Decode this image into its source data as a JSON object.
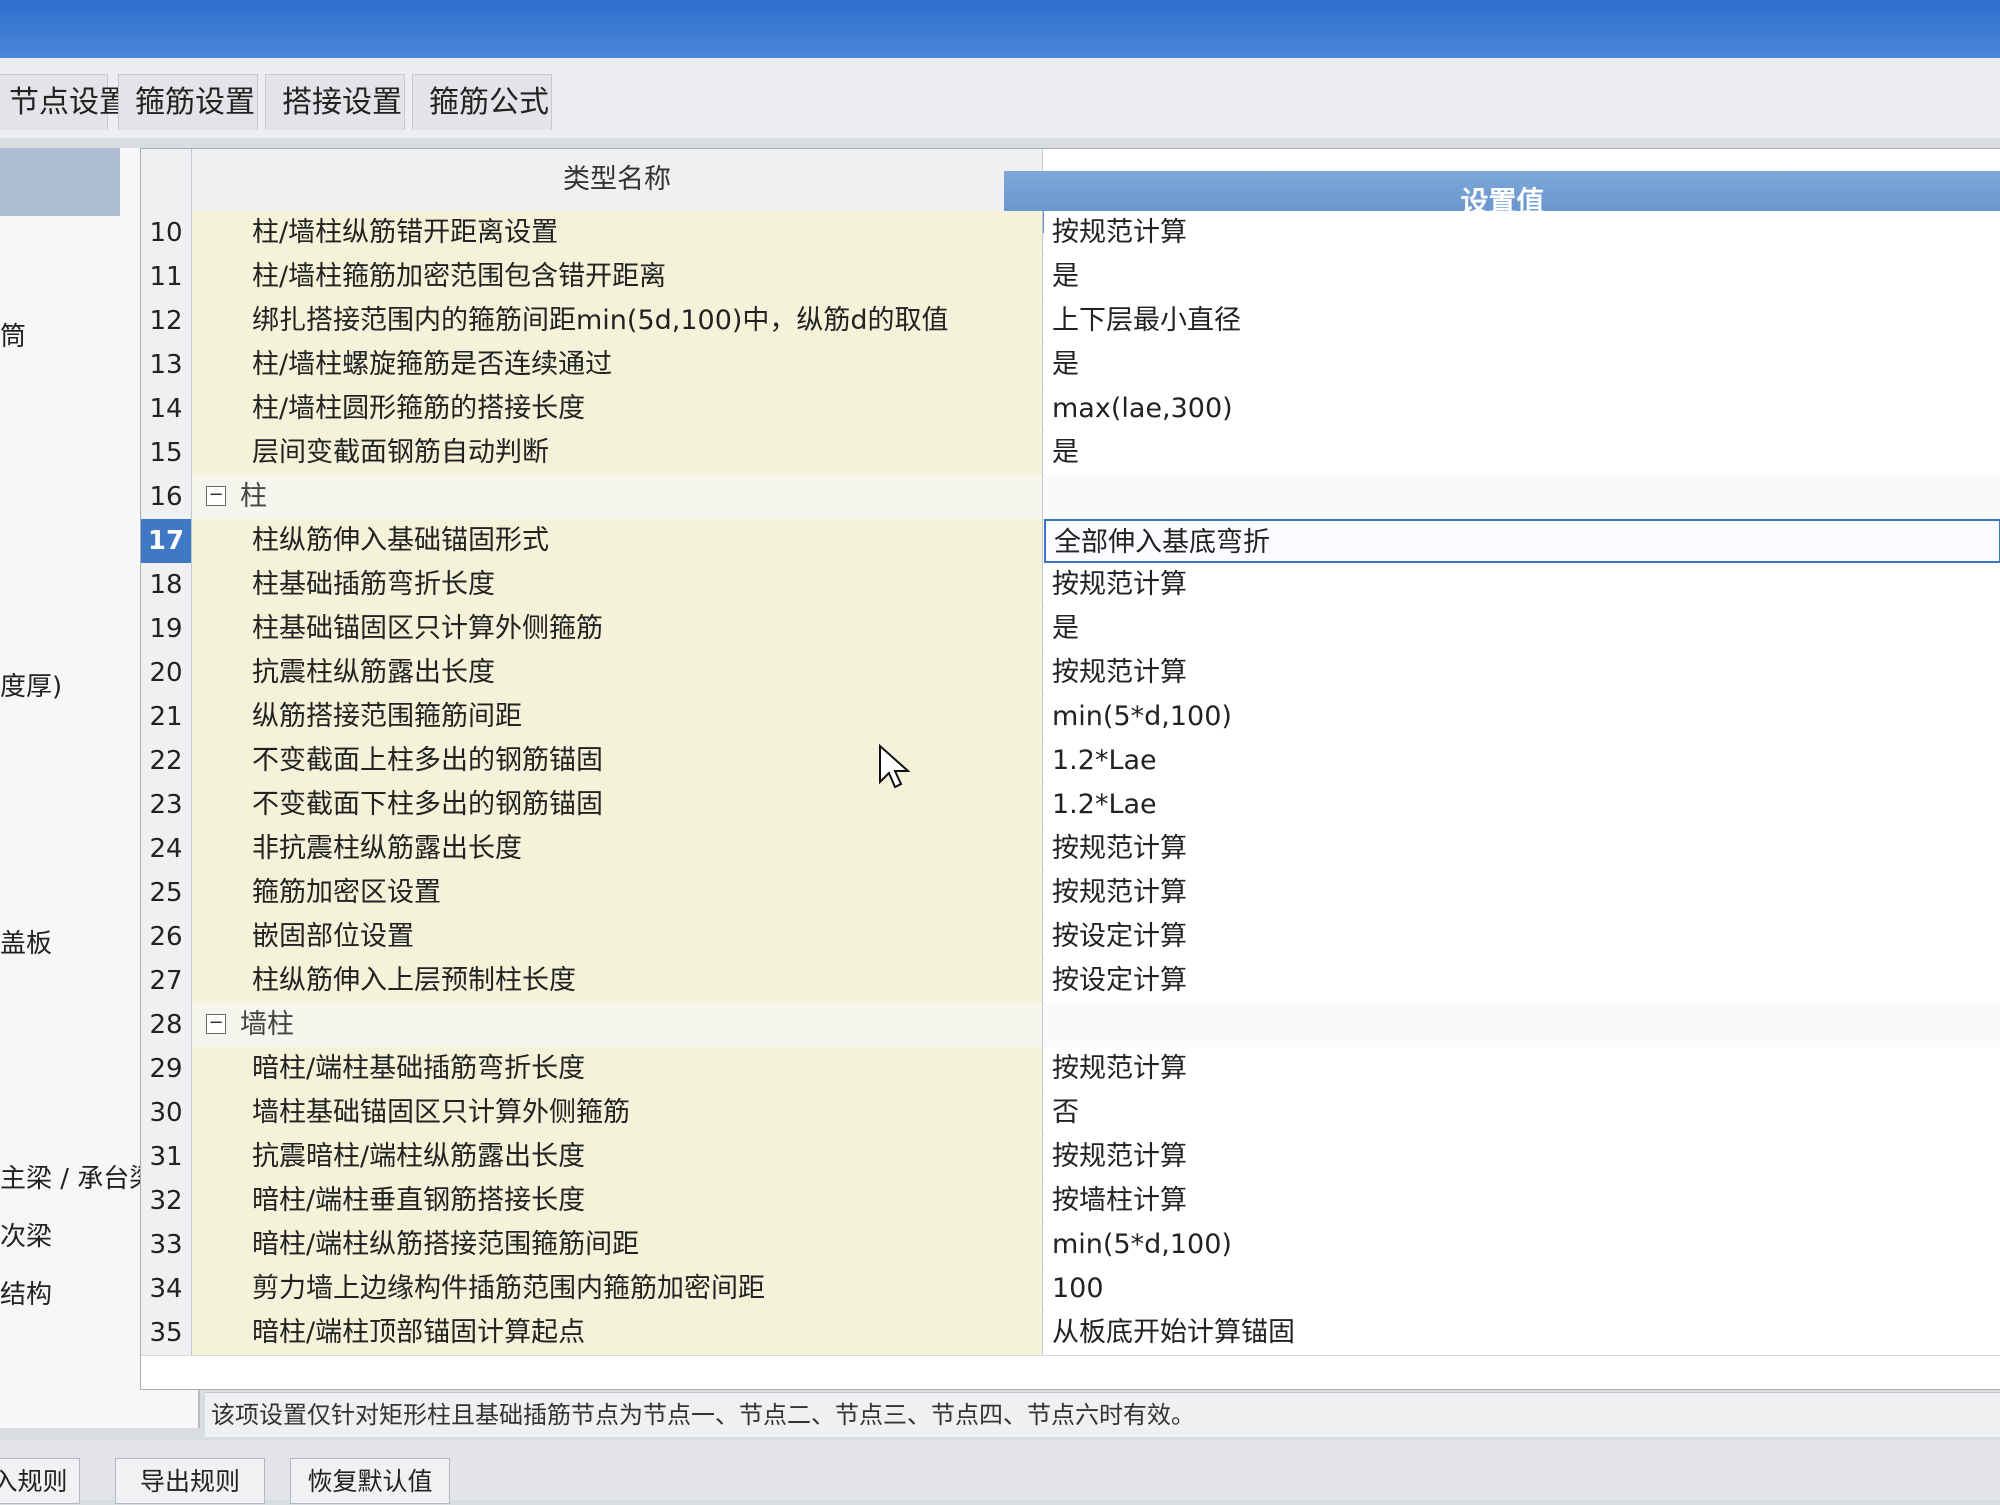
{
  "tabs": [
    {
      "label": "节点设置"
    },
    {
      "label": "箍筋设置"
    },
    {
      "label": "搭接设置"
    },
    {
      "label": "箍筋公式"
    }
  ],
  "left_panel": {
    "items": [
      {
        "label": "筒"
      },
      {
        "label": "度厚)"
      },
      {
        "label": "盖板"
      },
      {
        "label": "主梁 / 承台梁"
      },
      {
        "label": "次梁"
      },
      {
        "label": "结构"
      }
    ]
  },
  "grid": {
    "columns": {
      "name": "类型名称",
      "value": "设置值"
    },
    "rows": [
      {
        "num": "10",
        "name": "柱/墙柱纵筋错开距离设置",
        "value": "按规范计算"
      },
      {
        "num": "11",
        "name": "柱/墙柱箍筋加密范围包含错开距离",
        "value": "是"
      },
      {
        "num": "12",
        "name": "绑扎搭接范围内的箍筋间距min(5d,100)中，纵筋d的取值",
        "value": "上下层最小直径"
      },
      {
        "num": "13",
        "name": "柱/墙柱螺旋箍筋是否连续通过",
        "value": "是"
      },
      {
        "num": "14",
        "name": "柱/墙柱圆形箍筋的搭接长度",
        "value": "max(lae,300)"
      },
      {
        "num": "15",
        "name": "层间变截面钢筋自动判断",
        "value": "是"
      },
      {
        "num": "16",
        "name": "柱",
        "value": "",
        "group": true,
        "toggle": "−"
      },
      {
        "num": "17",
        "name": "柱纵筋伸入基础锚固形式",
        "value": "全部伸入基底弯折",
        "selected": true
      },
      {
        "num": "18",
        "name": "柱基础插筋弯折长度",
        "value": "按规范计算"
      },
      {
        "num": "19",
        "name": "柱基础锚固区只计算外侧箍筋",
        "value": "是"
      },
      {
        "num": "20",
        "name": "抗震柱纵筋露出长度",
        "value": "按规范计算"
      },
      {
        "num": "21",
        "name": "纵筋搭接范围箍筋间距",
        "value": "min(5*d,100)"
      },
      {
        "num": "22",
        "name": "不变截面上柱多出的钢筋锚固",
        "value": "1.2*Lae"
      },
      {
        "num": "23",
        "name": "不变截面下柱多出的钢筋锚固",
        "value": "1.2*Lae"
      },
      {
        "num": "24",
        "name": "非抗震柱纵筋露出长度",
        "value": "按规范计算"
      },
      {
        "num": "25",
        "name": "箍筋加密区设置",
        "value": "按规范计算"
      },
      {
        "num": "26",
        "name": "嵌固部位设置",
        "value": "按设定计算"
      },
      {
        "num": "27",
        "name": "柱纵筋伸入上层预制柱长度",
        "value": "按设定计算"
      },
      {
        "num": "28",
        "name": "墙柱",
        "value": "",
        "group": true,
        "toggle": "−"
      },
      {
        "num": "29",
        "name": "暗柱/端柱基础插筋弯折长度",
        "value": "按规范计算"
      },
      {
        "num": "30",
        "name": "墙柱基础锚固区只计算外侧箍筋",
        "value": "否"
      },
      {
        "num": "31",
        "name": "抗震暗柱/端柱纵筋露出长度",
        "value": "按规范计算"
      },
      {
        "num": "32",
        "name": "暗柱/端柱垂直钢筋搭接长度",
        "value": "按墙柱计算"
      },
      {
        "num": "33",
        "name": "暗柱/端柱纵筋搭接范围箍筋间距",
        "value": "min(5*d,100)"
      },
      {
        "num": "34",
        "name": "剪力墙上边缘构件插筋范围内箍筋加密间距",
        "value": "100"
      },
      {
        "num": "35",
        "name": "暗柱/端柱顶部锚固计算起点",
        "value": "从板底开始计算锚固"
      }
    ]
  },
  "status_text": "该项设置仅针对矩形柱且基础插筋节点为节点一、节点二、节点三、节点四、节点六时有效。",
  "buttons": {
    "import": "入规则",
    "export": "导出规则",
    "restore": "恢复默认值"
  },
  "colors": {
    "accent": "#3f78c4",
    "header_value_bg": "#6b97cf",
    "name_cell_bg": "#f4f3da"
  }
}
